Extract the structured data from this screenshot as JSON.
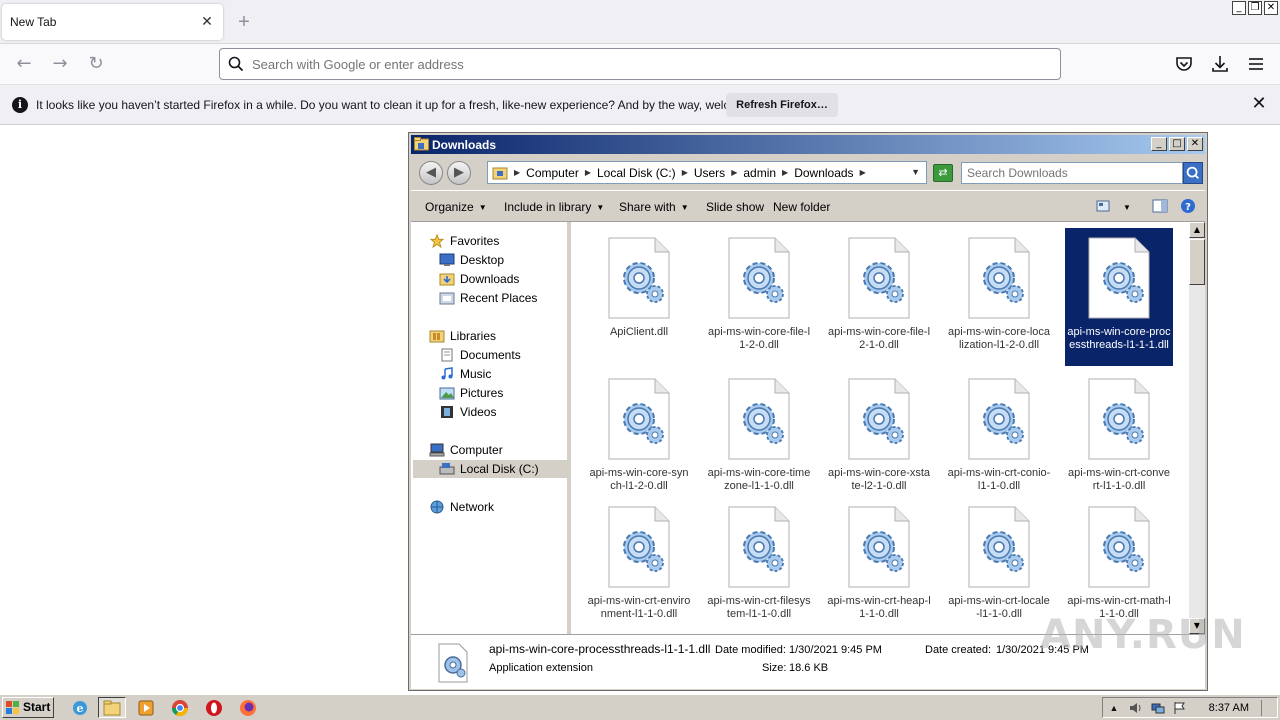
{
  "browser": {
    "tab_title": "New Tab",
    "tab_close": "✕",
    "new_tab": "+",
    "url_placeholder": "Search with Google or enter address",
    "notification": {
      "text": "It looks like you haven’t started Firefox in a while. Do you want to clean it up for a fresh, like-new experience? And by the way, welcome back!",
      "button": "Refresh Firefox…",
      "close": "✕",
      "info_glyph": "i"
    }
  },
  "window_caption": {
    "minimize": "_",
    "restore": "❐",
    "close": "✕"
  },
  "explorer": {
    "title": "Downloads",
    "breadcrumb": [
      "Computer",
      "Local Disk (C:)",
      "Users",
      "admin",
      "Downloads"
    ],
    "search_placeholder": "Search Downloads",
    "toolbar": {
      "organize": "Organize",
      "include_in_library": "Include in library",
      "share_with": "Share with",
      "slide_show": "Slide show",
      "new_folder": "New folder"
    },
    "nav": {
      "favorites": "Favorites",
      "desktop": "Desktop",
      "downloads": "Downloads",
      "recent_places": "Recent Places",
      "libraries": "Libraries",
      "documents": "Documents",
      "music": "Music",
      "pictures": "Pictures",
      "videos": "Videos",
      "computer": "Computer",
      "local_disk": "Local Disk (C:)",
      "network": "Network"
    },
    "files": [
      "ApiClient.dll",
      "api-ms-win-core-file-l1-2-0.dll",
      "api-ms-win-core-file-l2-1-0.dll",
      "api-ms-win-core-localization-l1-2-0.dll",
      "api-ms-win-core-processthreads-l1-1-1.dll",
      "api-ms-win-core-synch-l1-2-0.dll",
      "api-ms-win-core-timezone-l1-1-0.dll",
      "api-ms-win-core-xstate-l2-1-0.dll",
      "api-ms-win-crt-conio-l1-1-0.dll",
      "api-ms-win-crt-convert-l1-1-0.dll",
      "api-ms-win-crt-environment-l1-1-0.dll",
      "api-ms-win-crt-filesystem-l1-1-0.dll",
      "api-ms-win-crt-heap-l1-1-0.dll",
      "api-ms-win-crt-locale-l1-1-0.dll",
      "api-ms-win-crt-math-l1-1-0.dll"
    ],
    "selected_file": "api-ms-win-core-processthreads-l1-1-1.dll",
    "details": {
      "name": "api-ms-win-core-processthreads-l1-1-1.dll",
      "type": "Application extension",
      "date_modified_label": "Date modified:",
      "date_modified": "1/30/2021 9:45 PM",
      "size_label": "Size:",
      "size": "18.6 KB",
      "date_created_label": "Date created:",
      "date_created": "1/30/2021 9:45 PM"
    }
  },
  "watermark": "ANY.RUN",
  "taskbar": {
    "start": "Start",
    "clock": "8:37 AM",
    "apps": [
      "internet-explorer-icon",
      "windows-explorer-icon",
      "media-player-icon",
      "chrome-icon",
      "opera-icon",
      "firefox-icon"
    ]
  },
  "colors": {
    "selection": "#0a246a",
    "titlebar_start": "#0a246a",
    "titlebar_end": "#a6caf0",
    "firefox_chrome": "#f0f0f4"
  }
}
